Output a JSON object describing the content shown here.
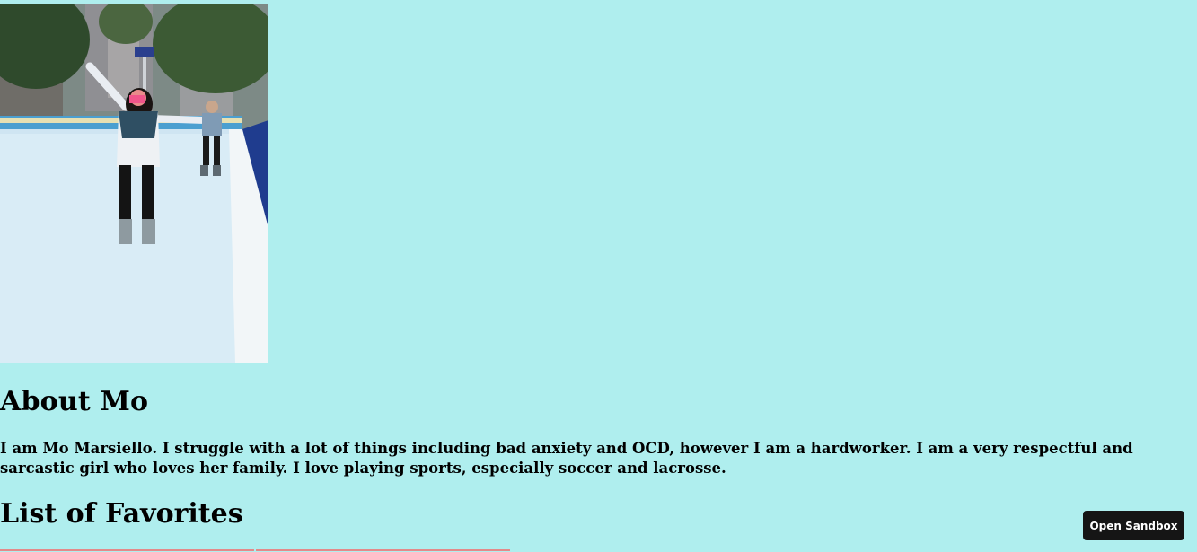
{
  "about": {
    "heading": "About Mo",
    "text": "I am Mo Marsiello. I struggle with a lot of things including bad anxiety and OCD, however I am a hardworker. I am a very respectful and sarcastic girl who loves her family. I love playing sports, especially soccer and lacrosse."
  },
  "favorites": {
    "heading": "List of Favorites"
  },
  "sandbox": {
    "button_label": "Open Sandbox"
  },
  "colors": {
    "page_background": "#afeeee",
    "button_background": "#151515"
  }
}
